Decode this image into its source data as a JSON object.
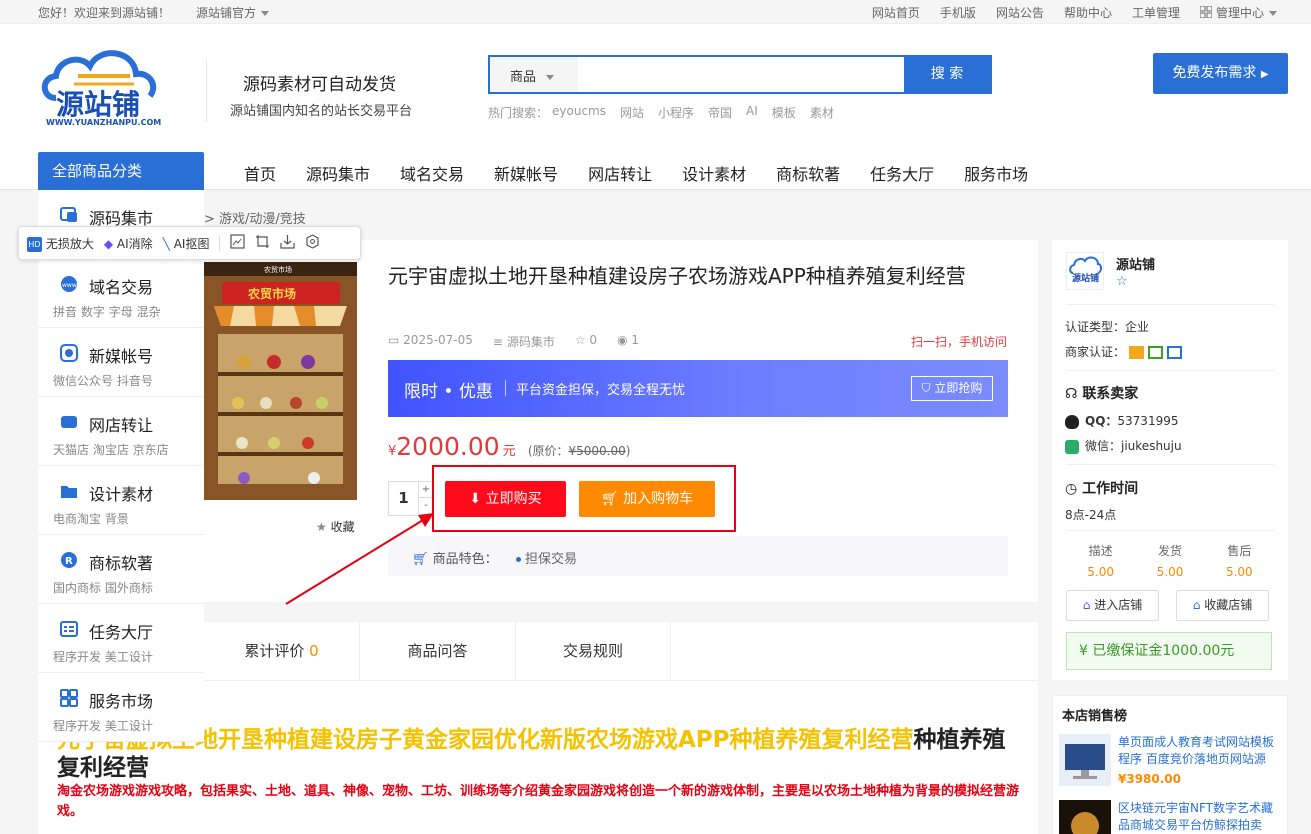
{
  "topbar": {
    "welcome": "您好！欢迎来到源站铺！",
    "official": "源站铺官方",
    "links": [
      "网站首页",
      "手机版",
      "网站公告",
      "帮助中心",
      "工单管理"
    ],
    "admin": "管理中心"
  },
  "header": {
    "logo_text": "源站铺",
    "logo_url_text": "WWW.YUANZHANPU.COM",
    "slogan_main": "源码素材可自动发货",
    "slogan_sub": "源站铺国内知名的站长交易平台",
    "search": {
      "category": "商品",
      "value": "",
      "button": "搜 索"
    },
    "hot_label": "热门搜索：",
    "hot_words": [
      "eyoucms",
      "网站",
      "小程序",
      "帝国",
      "AI",
      "模板",
      "素材"
    ],
    "publish_button": "免费发布需求"
  },
  "nav": {
    "all_categories": "全部商品分类",
    "links": [
      "首页",
      "源码集市",
      "域名交易",
      "新媒帐号",
      "网店转让",
      "设计素材",
      "商标软著",
      "任务大厅",
      "服务市场"
    ]
  },
  "categories": [
    {
      "title": "源码集市",
      "sub": ""
    },
    {
      "title": "域名交易",
      "sub": "拼音  数字  字母  混杂"
    },
    {
      "title": "新媒帐号",
      "sub": "微信公众号  抖音号"
    },
    {
      "title": "网店转让",
      "sub": "天猫店  淘宝店  京东店"
    },
    {
      "title": "设计素材",
      "sub": "电商淘宝  背景"
    },
    {
      "title": "商标软著",
      "sub": "国内商标  国外商标"
    },
    {
      "title": "任务大厅",
      "sub": "程序开发  美工设计"
    },
    {
      "title": "服务市场",
      "sub": "程序开发  美工设计"
    }
  ],
  "ai_toolbar": {
    "items": [
      "无损放大",
      "AI消除",
      "AI抠图"
    ]
  },
  "breadcrumb": "> 游戏/动漫/竞技",
  "product": {
    "image_caption": "农贸市场",
    "image_banner": "农贸市场",
    "collect": "收藏",
    "title": "元宇宙虚拟土地开垦种植建设房子农场游戏APP种植养殖复利经营",
    "date": "2025-07-05",
    "category": "源码集市",
    "likes": "0",
    "views": "1",
    "scan": "扫一扫，手机访问",
    "promo": {
      "big": "限时 • 优惠",
      "small": "平台资金担保，交易全程无忧",
      "grab": "立即抢购"
    },
    "price": {
      "currency": "¥",
      "value": "2000.00",
      "unit": "元",
      "original_label": "(原价：",
      "original_value": "¥5000.00",
      "original_close": ")"
    },
    "quantity": "1",
    "buy_button": "立即购买",
    "cart_button": "加入购物车",
    "features_label": "商品特色：",
    "features_value": "担保交易"
  },
  "tabs": [
    {
      "label": "累计评价",
      "count": "0"
    },
    {
      "label": "商品问答",
      "count": ""
    },
    {
      "label": "交易规则",
      "count": ""
    }
  ],
  "description": {
    "heading_yellow": "元宇宙虚拟土地开垦种植建设房子黄金家园优化新版农场游戏APP种植养殖复利经营",
    "heading_black": "种植养殖复利经营",
    "red_text": "淘金农场游戏游戏攻略，包括果实、土地、道具、神像、宠物、工坊、训练场等介绍黄金家园游戏将创造一个新的游戏体制，主要是以农场土地种植为背景的模拟经营游戏。"
  },
  "shop": {
    "name": "源站铺",
    "cert_type_label": "认证类型：",
    "cert_type": "企业",
    "merchant_cert_label": "商家认证：",
    "contact_title": "联系卖家",
    "qq_label": "QQ：",
    "qq": "53731995",
    "wechat_label": "微信：",
    "wechat": "jiukeshuju",
    "hours_title": "工作时间",
    "hours": "8点-24点",
    "stats": [
      {
        "label": "描述",
        "value": "5.00"
      },
      {
        "label": "发货",
        "value": "5.00"
      },
      {
        "label": "售后",
        "value": "5.00"
      }
    ],
    "enter_button": "进入店铺",
    "favorite_button": "收藏店铺",
    "deposit_label": "已缴保证金",
    "deposit_value": "1000.00元"
  },
  "bestsellers": {
    "title": "本店销售榜",
    "items": [
      {
        "title": "单页面成人教育考试网站模板程序 百度竞价落地页网站源",
        "price": "¥3980.00"
      },
      {
        "title": "区块链元宇宙NFT数字艺术藏品商城交易平台仿鲸探拍卖",
        "price": ""
      }
    ]
  },
  "colors": {
    "primary": "#2a6fd6",
    "red": "#ff0a1a",
    "orange": "#ff8a00",
    "highlight_box": "#e60012"
  }
}
